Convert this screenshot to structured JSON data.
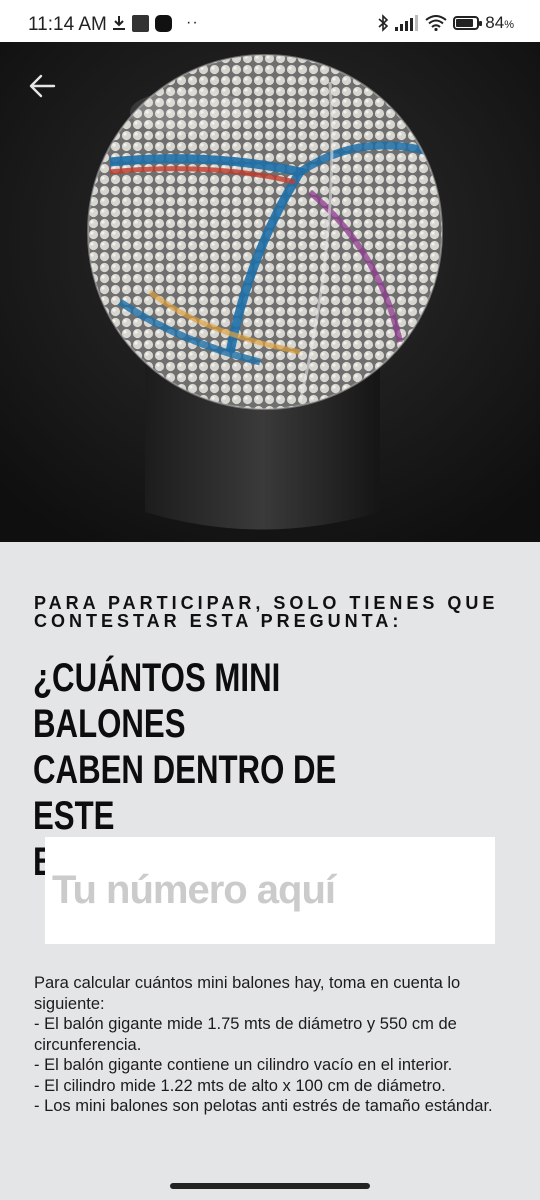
{
  "status_bar": {
    "time": "11:14 AM",
    "battery_percent": "84",
    "battery_unit": "%",
    "battery_level": 0.84,
    "icons": [
      "download-icon",
      "gallery-icon",
      "app-icon",
      "more-dots",
      "bluetooth-icon",
      "signal-icon",
      "wifi-icon",
      "battery-icon"
    ]
  },
  "hero": {
    "image_desc_icon": "soccer-ball-display",
    "back_icon": "arrow-left-icon"
  },
  "content": {
    "intro": "PARA PARTICIPAR, SOLO TIENES QUE CONTESTAR ESTA PREGUNTA:",
    "question": "¿CUÁNTOS MINI BALONES\nCABEN DENTRO DE ESTE\nBALÓN GIGANTE?",
    "answer_placeholder": "Tu número aquí",
    "answer_value": "",
    "instructions": [
      "Para calcular cuántos mini balones hay, toma en cuenta lo siguiente:",
      "- El balón gigante mide 1.75 mts de diámetro y 550 cm de circunferencia.",
      "- El balón gigante contiene un cilindro vacío en el interior.",
      "- El cilindro mide 1.22 mts de alto x 100 cm de diámetro.",
      "- Los mini balones son pelotas anti estrés de tamaño estándar."
    ]
  },
  "colors": {
    "background": "#e4e5e7",
    "hero_bg": "#1a1a1a",
    "text": "#111111",
    "placeholder": "#cbcbcb"
  }
}
